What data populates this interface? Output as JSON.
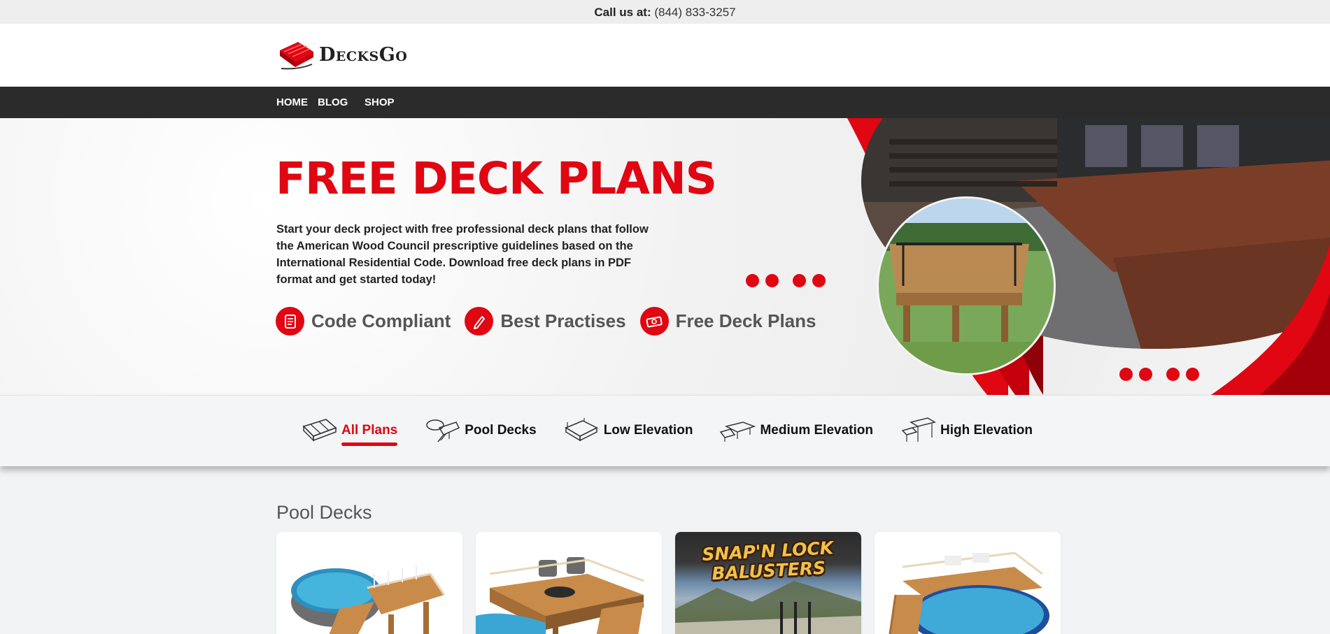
{
  "topbar": {
    "label": "Call us at:",
    "phone": "(844) 833-3257"
  },
  "brand": {
    "name": "DecksGo",
    "color": "#e00612"
  },
  "nav": {
    "items": [
      "HOME",
      "BLOG",
      "SHOP"
    ]
  },
  "hero": {
    "title": "FREE DECK PLANS",
    "description": "Start your deck project with free professional deck plans that follow the American Wood Council prescriptive guidelines based on the International Residential Code. Download free deck plans in PDF format and get started today!",
    "features": [
      {
        "label": "Code Compliant",
        "icon": "document-icon"
      },
      {
        "label": "Best Practises",
        "icon": "pencil-icon"
      },
      {
        "label": "Free Deck Plans",
        "icon": "money-icon"
      }
    ]
  },
  "filters": [
    {
      "label": "All Plans",
      "icon": "deck-boards-icon",
      "active": true
    },
    {
      "label": "Pool Decks",
      "icon": "pool-deck-icon",
      "active": false
    },
    {
      "label": "Low Elevation",
      "icon": "low-deck-icon",
      "active": false
    },
    {
      "label": "Medium Elevation",
      "icon": "medium-deck-icon",
      "active": false
    },
    {
      "label": "High Elevation",
      "icon": "high-deck-icon",
      "active": false
    }
  ],
  "section": {
    "title": "Pool Decks"
  },
  "cards": [
    {
      "type": "plan",
      "image": "round-pool-with-stair-deck"
    },
    {
      "type": "plan",
      "image": "pool-deck-with-lounge-chairs"
    },
    {
      "type": "ad",
      "title": "SNAP'N LOCK BALUSTERS"
    },
    {
      "type": "plan",
      "image": "wraparound-pool-deck"
    }
  ]
}
